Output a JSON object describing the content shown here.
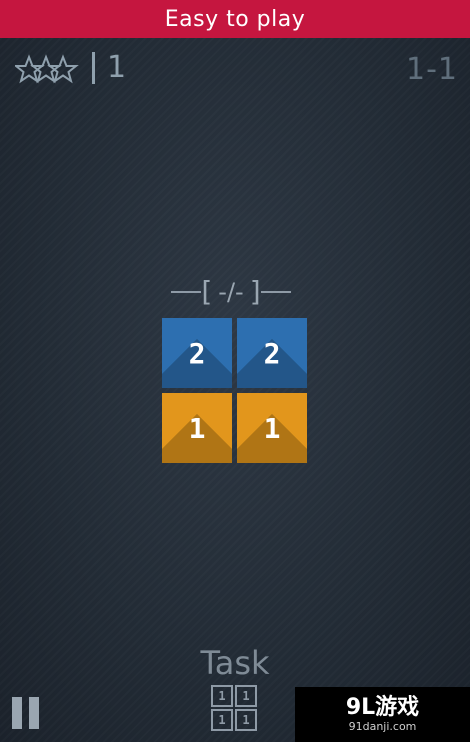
{
  "banner": {
    "text": "Easy to play",
    "color": "#c5163f"
  },
  "hud": {
    "stars_icon": "stars-icon",
    "star_count": "1",
    "level": "1-1"
  },
  "target": {
    "bracket_left": "[",
    "value": "-/-",
    "bracket_right": "]"
  },
  "tiles": [
    {
      "value": "2",
      "color": "blue"
    },
    {
      "value": "2",
      "color": "blue"
    },
    {
      "value": "1",
      "color": "orange"
    },
    {
      "value": "1",
      "color": "orange"
    }
  ],
  "task": {
    "label": "Task",
    "cells": [
      "1",
      "1",
      "1",
      "1"
    ]
  },
  "controls": {
    "pause_icon": "pause-icon"
  },
  "watermark": {
    "main": "9L游戏",
    "sub": "91danji.com"
  },
  "colors": {
    "blue_tile": "#2d6fb0",
    "orange_tile": "#e2961c",
    "background": "#222b35"
  }
}
